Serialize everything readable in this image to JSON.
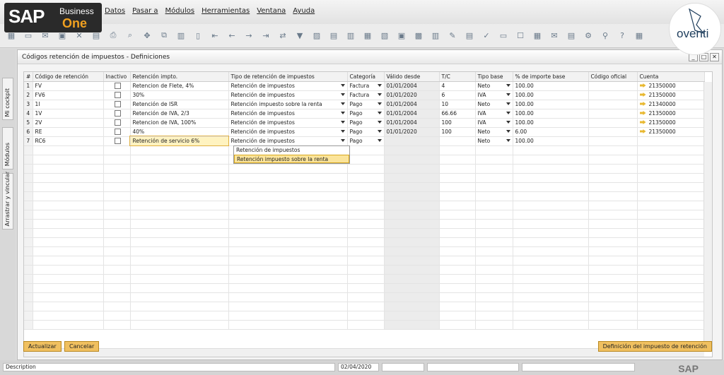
{
  "app": {
    "logo_sap": "SAP",
    "logo_business": "Business",
    "logo_one": "One",
    "watermark": "oventi"
  },
  "menu": [
    "Datos",
    "Pasar a",
    "Módulos",
    "Herramientas",
    "Ventana",
    "Ayuda"
  ],
  "sidebar_tabs": [
    "Mi cockpit",
    "Módulos",
    "Arrastrar y vincular"
  ],
  "window": {
    "title": "Códigos retención de impuestos - Definiciones"
  },
  "columns": [
    "#",
    "Código de retención",
    "Inactivo",
    "Retención impto.",
    "Tipo de retención de impuestos",
    "Categoría",
    "Válido desde",
    "T/C",
    "Tipo base",
    "% de importe base",
    "Código oficial",
    "Cuenta"
  ],
  "rows": [
    {
      "n": "1",
      "code": "FV",
      "name": "Retencion de Flete, 4%",
      "type": "Retención de impuestos",
      "cat": "Factura",
      "date": "01/01/2004",
      "tc": "4",
      "base": "Neto",
      "pct": "100.00",
      "oficial": "",
      "cuenta": "21350000"
    },
    {
      "n": "2",
      "code": "FV6",
      "name": "30%",
      "type": "Retención de impuestos",
      "cat": "Factura",
      "date": "01/01/2020",
      "tc": "6",
      "base": "IVA",
      "pct": "100.00",
      "oficial": "",
      "cuenta": "21350000"
    },
    {
      "n": "3",
      "code": "1I",
      "name": "Retención de ISR",
      "type": "Retención impuesto sobre la renta",
      "cat": "Pago",
      "date": "01/01/2004",
      "tc": "10",
      "base": "Neto",
      "pct": "100.00",
      "oficial": "",
      "cuenta": "21340000"
    },
    {
      "n": "4",
      "code": "1V",
      "name": "Retención de IVA, 2/3",
      "type": "Retención de impuestos",
      "cat": "Pago",
      "date": "01/01/2004",
      "tc": "66.66",
      "base": "IVA",
      "pct": "100.00",
      "oficial": "",
      "cuenta": "21350000"
    },
    {
      "n": "5",
      "code": "2V",
      "name": "Retencion de IVA, 100%",
      "type": "Retención de impuestos",
      "cat": "Pago",
      "date": "01/01/2004",
      "tc": "100",
      "base": "IVA",
      "pct": "100.00",
      "oficial": "",
      "cuenta": "21350000"
    },
    {
      "n": "6",
      "code": "RE",
      "name": "40%",
      "type": "Retención de impuestos",
      "cat": "Pago",
      "date": "01/01/2020",
      "tc": "100",
      "base": "Neto",
      "pct": "6.00",
      "oficial": "",
      "cuenta": "21350000"
    },
    {
      "n": "7",
      "code": "RC6",
      "name": "Retención de servicio 6%",
      "type": "Retención de impuestos",
      "cat": "Pago",
      "date": "",
      "tc": "",
      "base": "Neto",
      "pct": "100.00",
      "oficial": "",
      "cuenta": ""
    }
  ],
  "dropdown": {
    "options": [
      "Retención de impuestos",
      "Retención impuesto sobre la renta"
    ],
    "selected": 1
  },
  "buttons": {
    "update": "Actualizar",
    "cancel": "Cancelar",
    "definition": "Definición del impuesto de retención"
  },
  "status": {
    "description": "Description",
    "date": "02/04/2020",
    "footer_logo": "SAP"
  }
}
